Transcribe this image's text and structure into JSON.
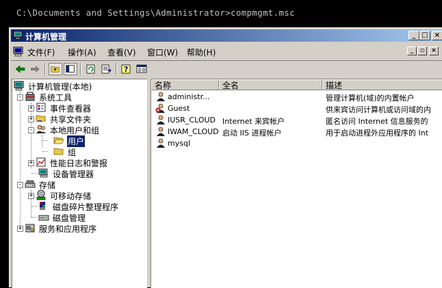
{
  "console": {
    "command_line": "C:\\Documents and Settings\\Administrator>compmgmt.msc"
  },
  "window": {
    "title": "计算机管理",
    "caption_buttons": {
      "minimize": "_",
      "maximize": "□",
      "close": "×"
    }
  },
  "menubar": {
    "items": [
      {
        "label": "文件(F)"
      },
      {
        "label": "操作(A)"
      },
      {
        "label": "查看(V)"
      },
      {
        "label": "窗口(W)"
      },
      {
        "label": "帮助(H)"
      }
    ]
  },
  "toolbar": {
    "buttons": [
      "back-icon",
      "forward-icon",
      "up-folder-icon",
      "show-hide-tree-icon",
      "refresh-icon",
      "export-list-icon",
      "help-icon",
      "properties-icon"
    ]
  },
  "tree": {
    "root": "计算机管理(本地)",
    "system_tools": "系统工具",
    "event_viewer": "事件查看器",
    "shared_folders": "共享文件夹",
    "local_users": "本地用户和组",
    "users": "用户",
    "groups": "组",
    "perf_logs": "性能日志和警报",
    "device_manager": "设备管理器",
    "storage": "存储",
    "removable": "可移动存储",
    "defrag": "磁盘碎片整理程序",
    "disk_mgmt": "磁盘管理",
    "services": "服务和应用程序"
  },
  "list": {
    "columns": {
      "name": "名称",
      "fullname": "全名",
      "description": "描述"
    },
    "rows": [
      {
        "name": "administr...",
        "fullname": "",
        "description": "管理计算机(域)的内置帐户",
        "disabled": false
      },
      {
        "name": "Guest",
        "fullname": "",
        "description": "供来宾访问计算机或访问域的内",
        "disabled": true
      },
      {
        "name": "IUSR_CLOUD",
        "fullname": "Internet 来宾帐户",
        "description": "匿名访问 Internet 信息服务的",
        "disabled": false
      },
      {
        "name": "IWAM_CLOUD",
        "fullname": "启动 IIS 进程帐户",
        "description": "用于启动进程外应用程序的 Int",
        "disabled": false
      },
      {
        "name": "mysql",
        "fullname": "",
        "description": "",
        "disabled": false
      }
    ]
  }
}
